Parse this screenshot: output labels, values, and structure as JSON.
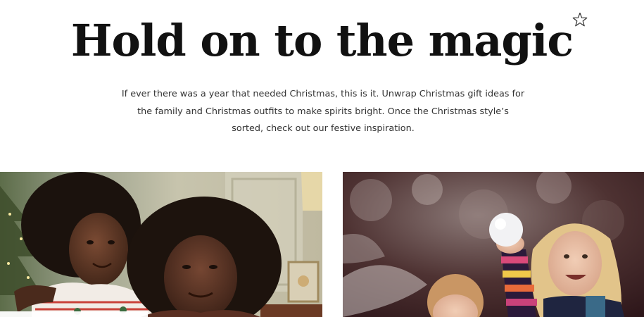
{
  "hero": {
    "title": "Hold on to the magic",
    "body": "If ever there was a year that needed Christmas, this is it. Unwrap Christmas gift ideas for the family and Christmas outfits to make spirits bright. Once the Christmas style’s sorted, check out our festive inspiration.",
    "favourite_icon": "star-outline-icon"
  },
  "tiles": [
    {
      "icon": "photo-mother-and-daughter"
    },
    {
      "icon": "photo-children-snowball"
    }
  ]
}
